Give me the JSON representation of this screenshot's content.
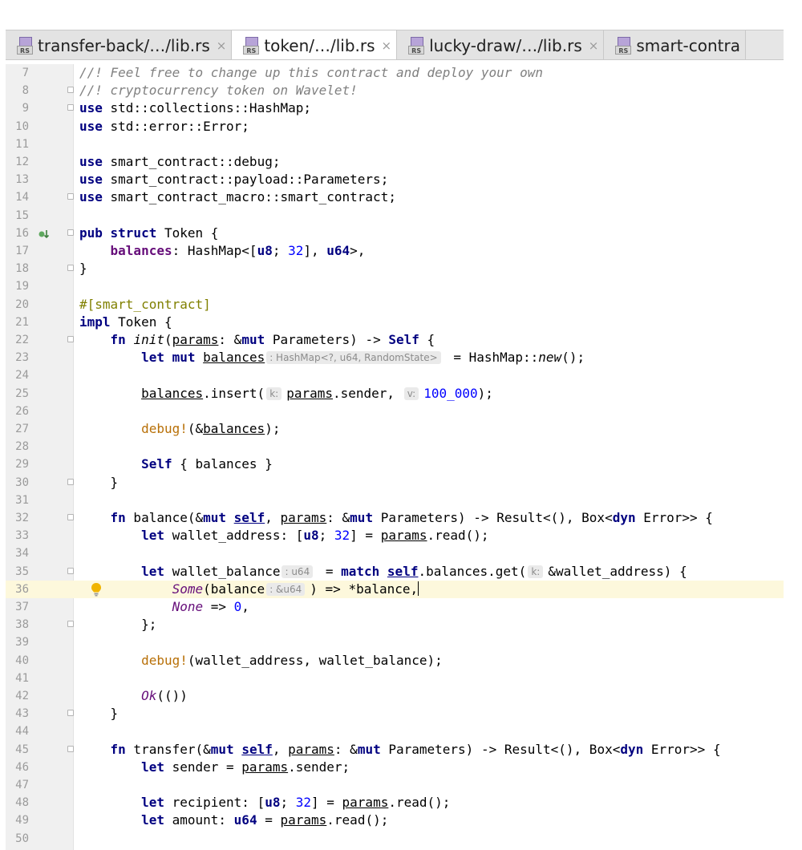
{
  "tabs": [
    {
      "label": "transfer-back/…/lib.rs",
      "active": false,
      "icon": "rust-file-icon"
    },
    {
      "label": "token/…/lib.rs",
      "active": true,
      "icon": "rust-file-icon"
    },
    {
      "label": "lucky-draw/…/lib.rs",
      "active": false,
      "icon": "rust-file-icon"
    },
    {
      "label": "smart-contra",
      "active": false,
      "icon": "rust-file-icon"
    }
  ],
  "tab_close_glyph": "×",
  "tab_icon_text": "RS",
  "editor": {
    "current_line": 36,
    "lines": [
      {
        "n": 7,
        "html": "<span class=\"cmt\">//! Feel free to change up this contract and deploy your own</span>"
      },
      {
        "n": 8,
        "fold": true,
        "html": "<span class=\"cmt\">//! cryptocurrency token on Wavelet!</span>"
      },
      {
        "n": 9,
        "fold": true,
        "html": "<span class=\"kw\">use</span> std::collections::HashMap;"
      },
      {
        "n": 10,
        "html": "<span class=\"kw\">use</span> std::error::Error;"
      },
      {
        "n": 11,
        "html": ""
      },
      {
        "n": 12,
        "html": "<span class=\"kw\">use</span> smart_contract::debug;"
      },
      {
        "n": 13,
        "html": "<span class=\"kw\">use</span> smart_contract::payload::Parameters;"
      },
      {
        "n": 14,
        "fold": true,
        "html": "<span class=\"kw\">use</span> smart_contract_macro::smart_contract;"
      },
      {
        "n": 15,
        "html": ""
      },
      {
        "n": 16,
        "fold": true,
        "impl_marker": true,
        "html": "<span class=\"kw\">pub struct</span> Token {"
      },
      {
        "n": 17,
        "html": "    <span class=\"bold\" style=\"color:#660e7a\">balances</span>: HashMap&lt;[<span class=\"kw\">u8</span>; <span class=\"num\">32</span>], <span class=\"kw\">u64</span>&gt;,"
      },
      {
        "n": 18,
        "fold": true,
        "html": "}"
      },
      {
        "n": 19,
        "html": ""
      },
      {
        "n": 20,
        "html": "<span class=\"attr\">#[smart_contract]</span>"
      },
      {
        "n": 21,
        "html": "<span class=\"kw\">impl</span> Token {"
      },
      {
        "n": 22,
        "fold": true,
        "html": "    <span class=\"kw\">fn</span> <span class=\"it\">init</span>(<span class=\"ul\">params</span>: &amp;<span class=\"kw\">mut</span> Parameters) -&gt; <span class=\"kw\">Self</span> {"
      },
      {
        "n": 23,
        "html": "        <span class=\"kw\">let mut</span> <span class=\"ul\">balances</span><span class=\"hint\">: HashMap&lt;?, u64, RandomState&gt;</span> = HashMap::<span class=\"it\">new</span>();"
      },
      {
        "n": 24,
        "html": ""
      },
      {
        "n": 25,
        "html": "        <span class=\"ul\">balances</span>.insert(<span class=\"hint\">k:</span><span class=\"ul\">params</span>.sender, <span class=\"hint\">v:</span><span class=\"num\">100_000</span>);"
      },
      {
        "n": 26,
        "html": ""
      },
      {
        "n": 27,
        "html": "        <span class=\"macro\">debug!</span>(&amp;<span class=\"ul\">balances</span>);"
      },
      {
        "n": 28,
        "html": ""
      },
      {
        "n": 29,
        "html": "        <span class=\"kw\">Self</span> { balances }"
      },
      {
        "n": 30,
        "fold": true,
        "html": "    }"
      },
      {
        "n": 31,
        "html": ""
      },
      {
        "n": 32,
        "fold": true,
        "html": "    <span class=\"kw\">fn</span> balance(&amp;<span class=\"kw\">mut</span> <span class=\"kw ul\">self</span>, <span class=\"ul\">params</span>: &amp;<span class=\"kw\">mut</span> Parameters) -&gt; Result&lt;(), Box&lt;<span class=\"kw\">dyn</span> Error&gt;&gt; {"
      },
      {
        "n": 33,
        "html": "        <span class=\"kw\">let</span> wallet_address: [<span class=\"kw\">u8</span>; <span class=\"num\">32</span>] = <span class=\"ul\">params</span>.read();"
      },
      {
        "n": 34,
        "html": ""
      },
      {
        "n": 35,
        "fold": true,
        "html": "        <span class=\"kw\">let</span> wallet_balance<span class=\"hint\">: u64</span> = <span class=\"kw\">match</span> <span class=\"kw ul\">self</span>.balances.get(<span class=\"hint\">k:</span>&amp;wallet_address) {"
      },
      {
        "n": 36,
        "bulb": true,
        "html": "            <span class=\"variant\">Some</span>(balance<span class=\"hint\">: &amp;u64</span>) =&gt; *balance,<span class=\"caret\"></span>"
      },
      {
        "n": 37,
        "html": "            <span class=\"variant\">None</span> =&gt; <span class=\"num\">0</span>,"
      },
      {
        "n": 38,
        "fold": true,
        "html": "        };"
      },
      {
        "n": 39,
        "html": ""
      },
      {
        "n": 40,
        "html": "        <span class=\"macro\">debug!</span>(wallet_address, wallet_balance);"
      },
      {
        "n": 41,
        "html": ""
      },
      {
        "n": 42,
        "html": "        <span class=\"variant\">Ok</span>(())"
      },
      {
        "n": 43,
        "fold": true,
        "html": "    }"
      },
      {
        "n": 44,
        "html": ""
      },
      {
        "n": 45,
        "fold": true,
        "html": "    <span class=\"kw\">fn</span> transfer(&amp;<span class=\"kw\">mut</span> <span class=\"kw ul\">self</span>, <span class=\"ul\">params</span>: &amp;<span class=\"kw\">mut</span> Parameters) -&gt; Result&lt;(), Box&lt;<span class=\"kw\">dyn</span> Error&gt;&gt; {"
      },
      {
        "n": 46,
        "html": "        <span class=\"kw\">let</span> sender = <span class=\"ul\">params</span>.sender;"
      },
      {
        "n": 47,
        "html": ""
      },
      {
        "n": 48,
        "html": "        <span class=\"kw\">let</span> recipient: [<span class=\"kw\">u8</span>; <span class=\"num\">32</span>] = <span class=\"ul\">params</span>.read();"
      },
      {
        "n": 49,
        "html": "        <span class=\"kw\">let</span> amount: <span class=\"kw\">u64</span> = <span class=\"ul\">params</span>.read();"
      },
      {
        "n": 50,
        "html": ""
      }
    ]
  }
}
